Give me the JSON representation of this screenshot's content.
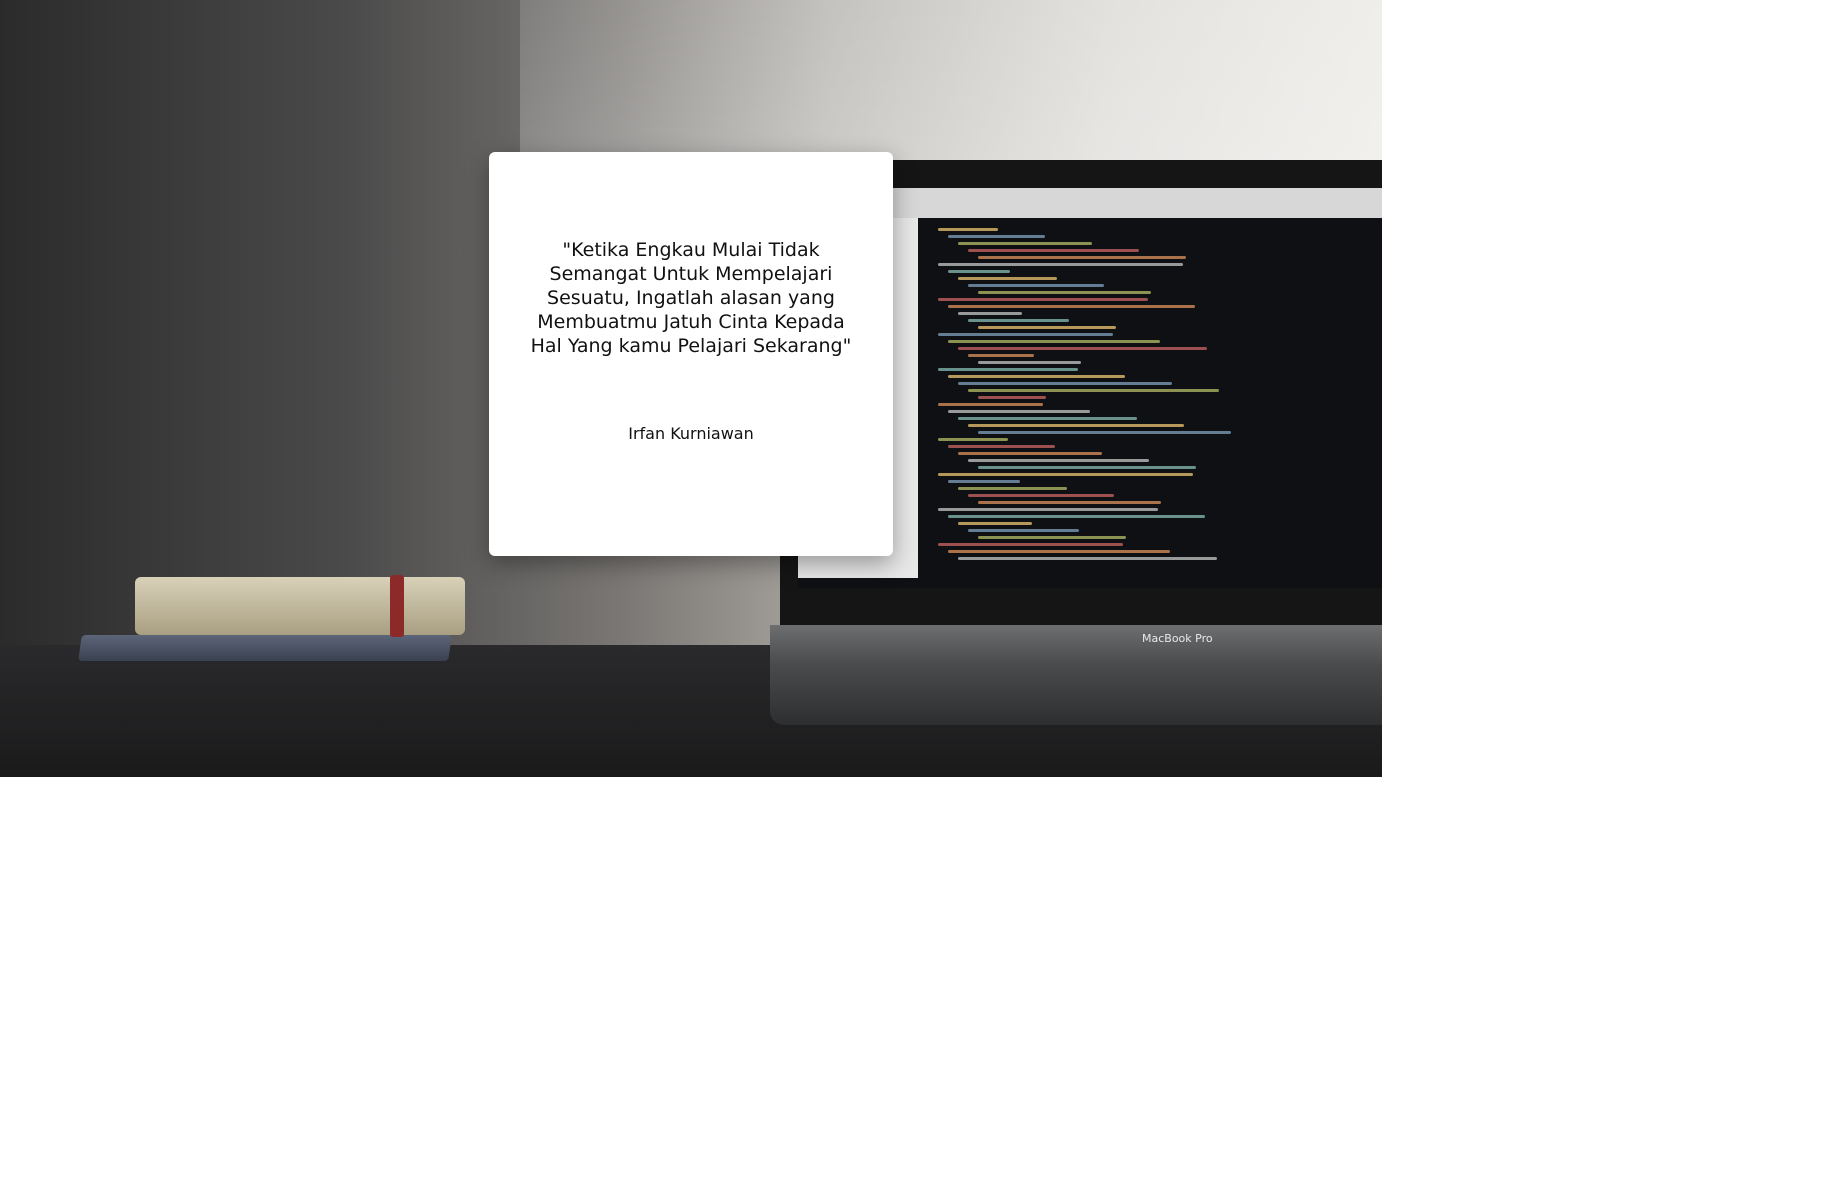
{
  "quote": {
    "text": "\"Ketika Engkau Mulai Tidak Semangat Untuk Mempelajari Sesuatu, Ingatlah alasan yang Membuatmu Jatuh Cinta Kepada Hal Yang kamu Pelajari Sekarang\"",
    "author": "Irfan Kurniawan"
  },
  "background": {
    "laptop_brand": "MacBook Pro"
  }
}
